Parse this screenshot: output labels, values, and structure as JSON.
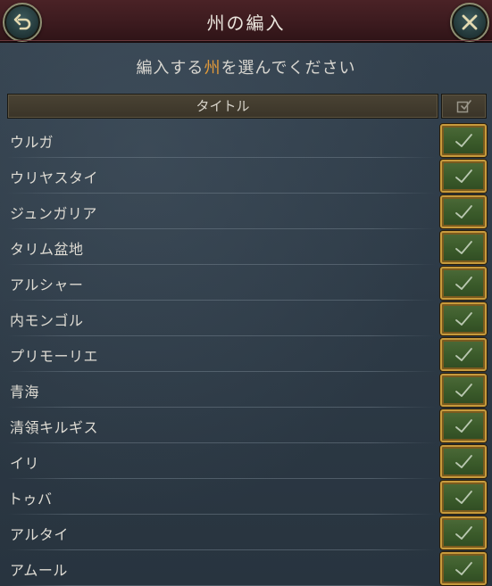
{
  "window": {
    "title": "州の編入"
  },
  "header": {
    "back_icon": "undo-arrow-icon",
    "close_icon": "close-x-icon"
  },
  "prompt": {
    "prefix": "編入する",
    "highlight": "州",
    "suffix": "を選んでください",
    "highlight_color": "#e39a3a"
  },
  "table": {
    "column_title": "タイトル",
    "select_all_icon": "checkbox-icon",
    "rows": [
      {
        "label": "ウルガ",
        "checked": true
      },
      {
        "label": "ウリヤスタイ",
        "checked": true
      },
      {
        "label": "ジュンガリア",
        "checked": true
      },
      {
        "label": "タリム盆地",
        "checked": true
      },
      {
        "label": "アルシャー",
        "checked": true
      },
      {
        "label": "内モンゴル",
        "checked": true
      },
      {
        "label": "プリモーリエ",
        "checked": true
      },
      {
        "label": "青海",
        "checked": true
      },
      {
        "label": "清領キルギス",
        "checked": true
      },
      {
        "label": "イリ",
        "checked": true
      },
      {
        "label": "トゥバ",
        "checked": true
      },
      {
        "label": "アルタイ",
        "checked": true
      },
      {
        "label": "アムール",
        "checked": true
      }
    ]
  },
  "colors": {
    "titlebar": "#3b1a1e",
    "panel": "#2d3a46",
    "checkbox_fill": "#3a5a2a",
    "checkbox_border": "#c79a3c"
  }
}
